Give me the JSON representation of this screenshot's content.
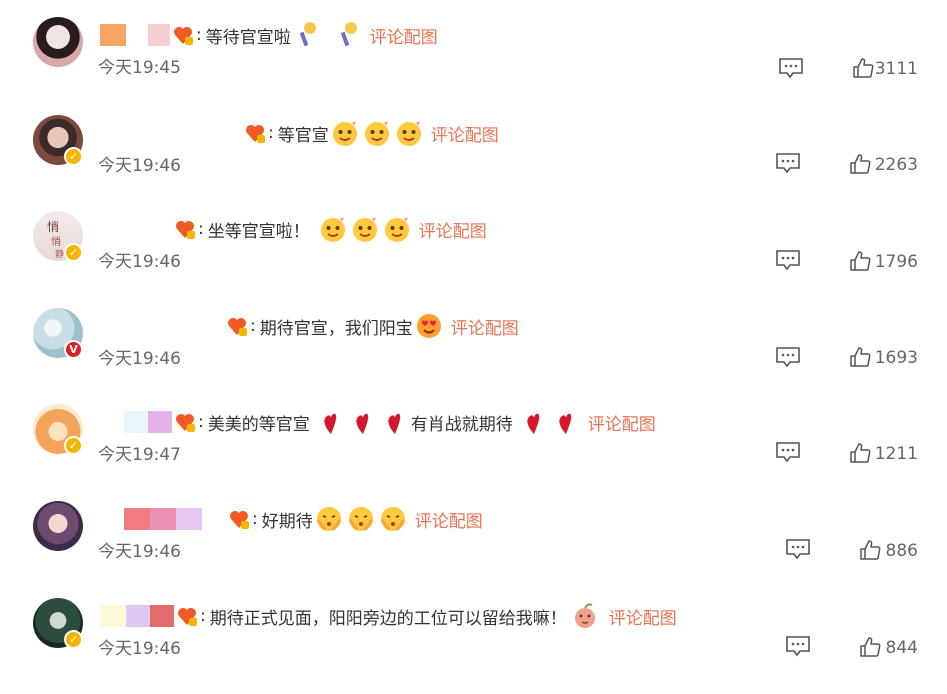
{
  "link_label": "评论配图",
  "comments": [
    {
      "name_colors": [
        "#f6a462",
        "#ffffff",
        "#f3d0cf"
      ],
      "text": "等待官宣啦",
      "emoji": "badminton",
      "emoji_count": 2,
      "time": "今天19:45",
      "likes": "3111",
      "verified": false,
      "avatar": "#c9a7a7"
    },
    {
      "name_colors": [
        "#ffffff",
        "#ffffff",
        "#ffffff"
      ],
      "text": "等官宣",
      "emoji": "love-face",
      "emoji_count": 3,
      "time": "今天19:46",
      "likes": "2263",
      "verified": "gold",
      "avatar": "#7a4a3c"
    },
    {
      "name_colors": [
        "#ffffff",
        "#ffffff",
        "#ffffff"
      ],
      "text": "坐等官宣啦！",
      "emoji": "love-face",
      "emoji_count": 3,
      "time": "今天19:46",
      "likes": "1796",
      "verified": "gold",
      "avatar": "#e8d7d5"
    },
    {
      "name_colors": [
        "#ffffff",
        "#ffffff",
        "#ffffff"
      ],
      "text": "期待官宣，我们阳宝",
      "emoji": "heart-eyes",
      "emoji_count": 1,
      "time": "今天19:46",
      "likes": "1693",
      "verified": "red",
      "avatar": "#a9c7d6"
    },
    {
      "name_colors": [
        "#ffffff",
        "#e8f6fb",
        "#e4b4e8"
      ],
      "text": "美美的等官宣",
      "emoji": "red-heart",
      "emoji_count": 3,
      "text2": "有肖战就期待",
      "emoji2_count": 2,
      "time": "今天19:47",
      "likes": "1211",
      "verified": "gold",
      "avatar": "#f3a35a"
    },
    {
      "name_colors": [
        "#f07b82",
        "#ec8fb5",
        "#e6c7ef"
      ],
      "text": "好期待",
      "emoji": "kiss-hands",
      "emoji_count": 3,
      "time": "今天19:46",
      "likes": "886",
      "verified": false,
      "avatar": "#7a5c7c"
    },
    {
      "name_colors": [
        "#fbf9d7",
        "#e0c9f1",
        "#e26c6c"
      ],
      "text": "期待正式见面，阳阳旁边的工位可以留给我嘛！",
      "emoji": "peach",
      "emoji_count": 1,
      "time": "今天19:46",
      "likes": "844",
      "verified": "gold",
      "avatar": "#2c4c3c"
    }
  ],
  "colors": {
    "link": "#eb7350",
    "verified_gold": "#f5b400",
    "verified_red": "#e01e1e",
    "text": "#333333",
    "meta": "#666666"
  }
}
